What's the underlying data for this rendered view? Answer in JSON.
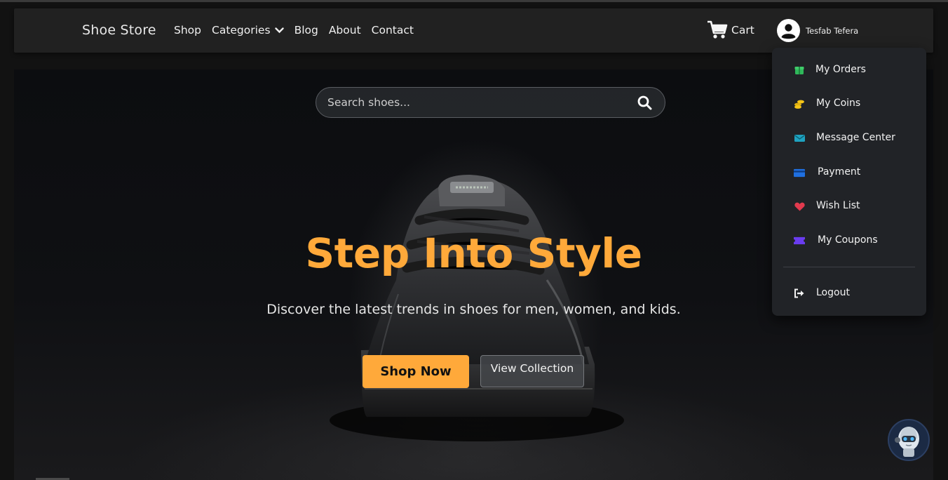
{
  "brand": "Shoe Store",
  "nav": {
    "shop": "Shop",
    "categories": "Categories",
    "blog": "Blog",
    "about": "About",
    "contact": "Contact"
  },
  "cart": {
    "label": "Cart",
    "icon": "cart-icon"
  },
  "user": {
    "name": "Tesfab Tefera",
    "icon": "user-avatar-icon"
  },
  "search": {
    "placeholder": "Search shoes...",
    "icon": "search-icon"
  },
  "hero": {
    "title": "Step Into Style",
    "subtitle": "Discover the latest trends in shoes for men, women, and kids.",
    "primary_button": "Shop Now",
    "secondary_button": "View Collection"
  },
  "dropdown": {
    "items": [
      {
        "label": "My Orders",
        "icon": "gift-icon",
        "color": "#2fb85a"
      },
      {
        "label": "My Coins",
        "icon": "coins-icon",
        "color": "#f5c518"
      },
      {
        "label": "Message Center",
        "icon": "envelope-icon",
        "color": "#1fa2c0"
      },
      {
        "label": "Payment",
        "icon": "credit-card-icon",
        "color": "#1f6fe0"
      },
      {
        "label": "Wish List",
        "icon": "heart-icon",
        "color": "#e23a4e"
      },
      {
        "label": "My Coupons",
        "icon": "ticket-icon",
        "color": "#6a3cf0"
      }
    ],
    "logout": {
      "label": "Logout",
      "icon": "logout-icon"
    }
  },
  "colors": {
    "accent": "#ffa93a",
    "navbar": "#212121",
    "dropdown": "#212327"
  }
}
